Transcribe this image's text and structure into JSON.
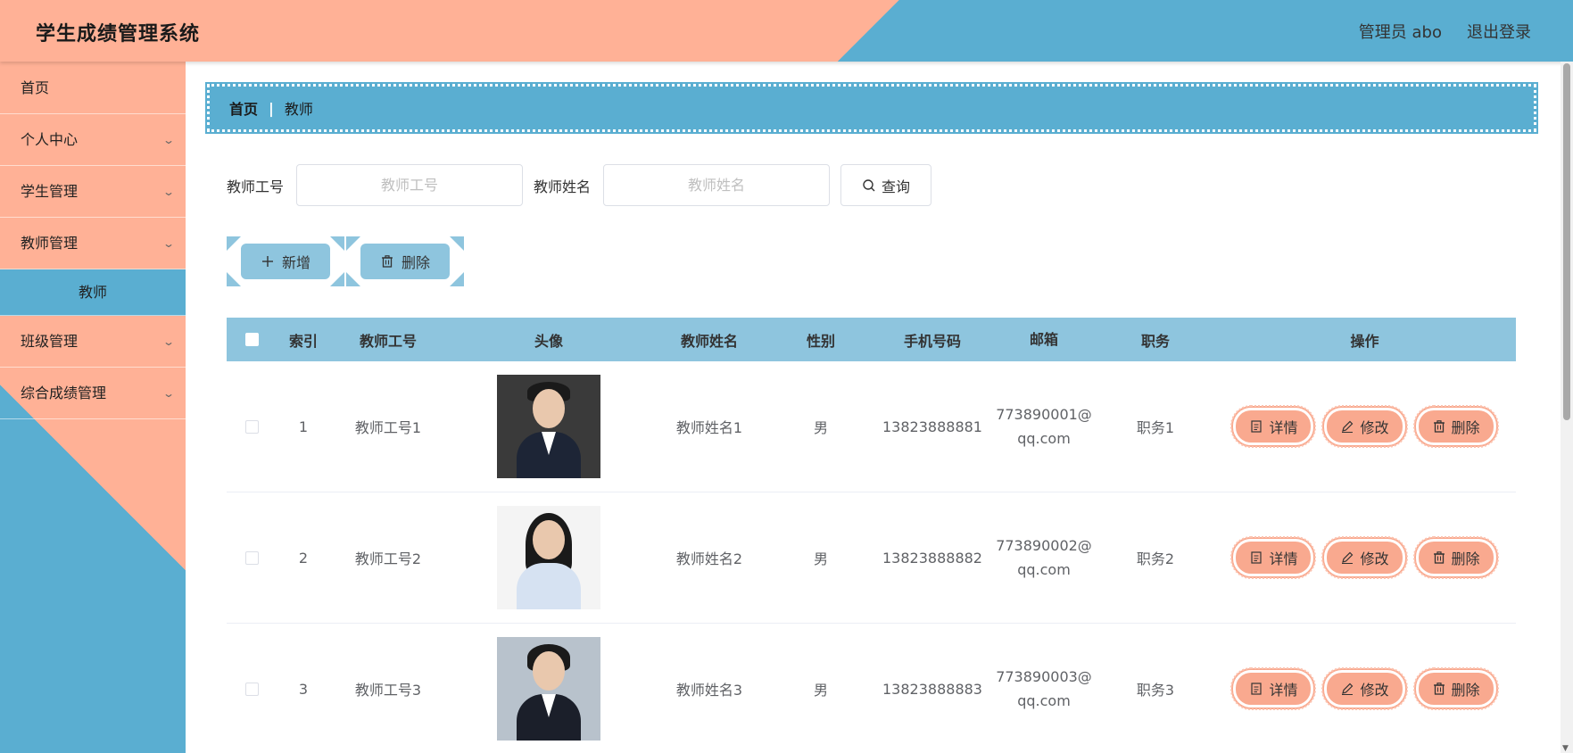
{
  "header": {
    "title": "学生成绩管理系统",
    "user": "管理员 abo",
    "logout": "退出登录"
  },
  "sidebar": {
    "items": [
      {
        "label": "首页",
        "has_chevron": false
      },
      {
        "label": "个人中心",
        "has_chevron": true
      },
      {
        "label": "学生管理",
        "has_chevron": true
      },
      {
        "label": "教师管理",
        "has_chevron": true
      },
      {
        "label": "教师",
        "active": true
      },
      {
        "label": "班级管理",
        "has_chevron": true
      },
      {
        "label": "综合成绩管理",
        "has_chevron": true
      }
    ]
  },
  "breadcrumb": {
    "home": "首页",
    "separator": "|",
    "current": "教师"
  },
  "search": {
    "teacher_no_label": "教师工号",
    "teacher_no_placeholder": "教师工号",
    "teacher_name_label": "教师姓名",
    "teacher_name_placeholder": "教师姓名",
    "query_label": "查询"
  },
  "actions": {
    "add_label": "新增",
    "delete_label": "删除"
  },
  "table": {
    "columns": [
      "索引",
      "教师工号",
      "头像",
      "教师姓名",
      "性别",
      "手机号码",
      "邮箱",
      "职务",
      "操作"
    ],
    "rows": [
      {
        "index": "1",
        "no": "教师工号1",
        "name": "教师姓名1",
        "sex": "男",
        "phone": "13823888881",
        "email_line1": "773890001@",
        "email_line2": "qq.com",
        "job": "职务1"
      },
      {
        "index": "2",
        "no": "教师工号2",
        "name": "教师姓名2",
        "sex": "男",
        "phone": "13823888882",
        "email_line1": "773890002@",
        "email_line2": "qq.com",
        "job": "职务2"
      },
      {
        "index": "3",
        "no": "教师工号3",
        "name": "教师姓名3",
        "sex": "男",
        "phone": "13823888883",
        "email_line1": "773890003@",
        "email_line2": "qq.com",
        "job": "职务3"
      }
    ],
    "op_detail": "详情",
    "op_edit": "修改",
    "op_delete": "删除"
  },
  "icons": {
    "search": "search-icon",
    "plus": "plus-icon",
    "trash": "trash-icon",
    "detail": "document-icon",
    "edit": "pencil-icon",
    "chevron": "chevron-down-icon"
  },
  "colors": {
    "salmon": "#ffb196",
    "blue": "#5aaed1",
    "light_blue": "#8ec5de",
    "op_button": "#f9a98f"
  }
}
